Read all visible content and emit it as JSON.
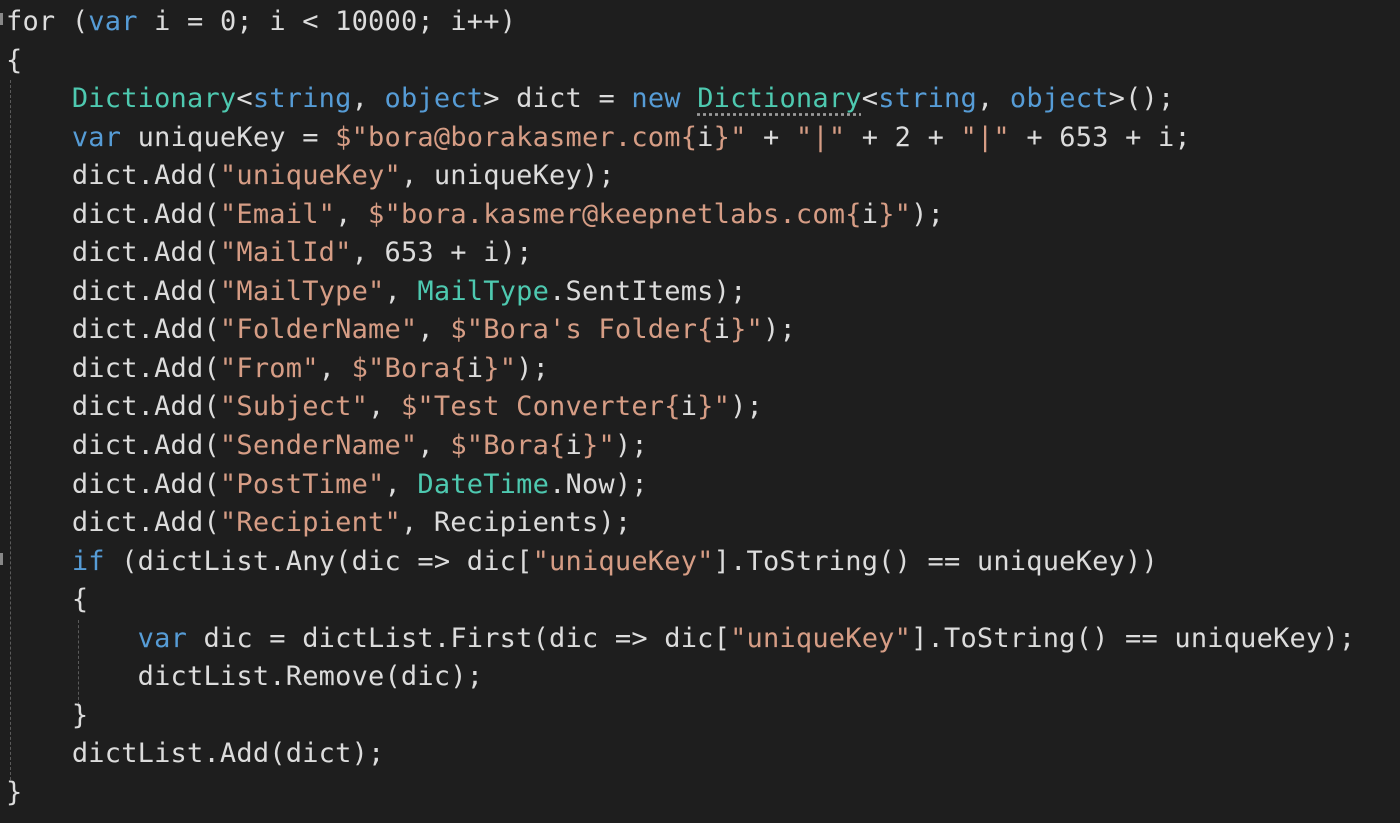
{
  "editor": {
    "theme_colors": {
      "background": "#1e1e1e",
      "keyword": "#569cd6",
      "string": "#d69d85",
      "type": "#4ec9b0",
      "plain": "#dcdcdc"
    },
    "lines": [
      [
        {
          "t": "for",
          "c": "pl"
        },
        {
          "t": " (",
          "c": "pl"
        },
        {
          "t": "var",
          "c": "kw"
        },
        {
          "t": " i = 0; i < 10000; i++)",
          "c": "pl"
        }
      ],
      [
        {
          "t": "{",
          "c": "pl"
        }
      ],
      [
        {
          "t": "    ",
          "c": "pl"
        },
        {
          "t": "Dictionary",
          "c": "ty"
        },
        {
          "t": "<",
          "c": "pl"
        },
        {
          "t": "string",
          "c": "kw"
        },
        {
          "t": ", ",
          "c": "pl"
        },
        {
          "t": "object",
          "c": "kw"
        },
        {
          "t": "> dict = ",
          "c": "pl"
        },
        {
          "t": "new",
          "c": "kw"
        },
        {
          "t": " ",
          "c": "pl"
        },
        {
          "t": "Dictionary",
          "c": "ty",
          "squiggle": true
        },
        {
          "t": "<",
          "c": "pl"
        },
        {
          "t": "string",
          "c": "kw"
        },
        {
          "t": ", ",
          "c": "pl"
        },
        {
          "t": "object",
          "c": "kw"
        },
        {
          "t": ">();",
          "c": "pl"
        }
      ],
      [
        {
          "t": "    ",
          "c": "pl"
        },
        {
          "t": "var",
          "c": "kw"
        },
        {
          "t": " uniqueKey = ",
          "c": "pl"
        },
        {
          "t": "$\"bora@borakasmer.com{",
          "c": "st"
        },
        {
          "t": "i",
          "c": "pl"
        },
        {
          "t": "}\"",
          "c": "st"
        },
        {
          "t": " + ",
          "c": "pl"
        },
        {
          "t": "\"|\"",
          "c": "st"
        },
        {
          "t": " + 2 + ",
          "c": "pl"
        },
        {
          "t": "\"|\"",
          "c": "st"
        },
        {
          "t": " + 653 + i;",
          "c": "pl"
        }
      ],
      [
        {
          "t": "    dict.Add(",
          "c": "pl"
        },
        {
          "t": "\"uniqueKey\"",
          "c": "st"
        },
        {
          "t": ", uniqueKey);",
          "c": "pl"
        }
      ],
      [
        {
          "t": "    dict.Add(",
          "c": "pl"
        },
        {
          "t": "\"Email\"",
          "c": "st"
        },
        {
          "t": ", ",
          "c": "pl"
        },
        {
          "t": "$\"bora.kasmer@keepnetlabs.com{",
          "c": "st"
        },
        {
          "t": "i",
          "c": "pl"
        },
        {
          "t": "}\"",
          "c": "st"
        },
        {
          "t": ");",
          "c": "pl"
        }
      ],
      [
        {
          "t": "    dict.Add(",
          "c": "pl"
        },
        {
          "t": "\"MailId\"",
          "c": "st"
        },
        {
          "t": ", 653 + i);",
          "c": "pl"
        }
      ],
      [
        {
          "t": "    dict.Add(",
          "c": "pl"
        },
        {
          "t": "\"MailType\"",
          "c": "st"
        },
        {
          "t": ", ",
          "c": "pl"
        },
        {
          "t": "MailType",
          "c": "ty"
        },
        {
          "t": ".SentItems);",
          "c": "pl"
        }
      ],
      [
        {
          "t": "    dict.Add(",
          "c": "pl"
        },
        {
          "t": "\"FolderName\"",
          "c": "st"
        },
        {
          "t": ", ",
          "c": "pl"
        },
        {
          "t": "$\"Bora's Folder{",
          "c": "st"
        },
        {
          "t": "i",
          "c": "pl"
        },
        {
          "t": "}\"",
          "c": "st"
        },
        {
          "t": ");",
          "c": "pl"
        }
      ],
      [
        {
          "t": "    dict.Add(",
          "c": "pl"
        },
        {
          "t": "\"From\"",
          "c": "st"
        },
        {
          "t": ", ",
          "c": "pl"
        },
        {
          "t": "$\"Bora{",
          "c": "st"
        },
        {
          "t": "i",
          "c": "pl"
        },
        {
          "t": "}\"",
          "c": "st"
        },
        {
          "t": ");",
          "c": "pl"
        }
      ],
      [
        {
          "t": "    dict.Add(",
          "c": "pl"
        },
        {
          "t": "\"Subject\"",
          "c": "st"
        },
        {
          "t": ", ",
          "c": "pl"
        },
        {
          "t": "$\"Test Converter{",
          "c": "st"
        },
        {
          "t": "i",
          "c": "pl"
        },
        {
          "t": "}\"",
          "c": "st"
        },
        {
          "t": ");",
          "c": "pl"
        }
      ],
      [
        {
          "t": "    dict.Add(",
          "c": "pl"
        },
        {
          "t": "\"SenderName\"",
          "c": "st"
        },
        {
          "t": ", ",
          "c": "pl"
        },
        {
          "t": "$\"Bora{",
          "c": "st"
        },
        {
          "t": "i",
          "c": "pl"
        },
        {
          "t": "}\"",
          "c": "st"
        },
        {
          "t": ");",
          "c": "pl"
        }
      ],
      [
        {
          "t": "    dict.Add(",
          "c": "pl"
        },
        {
          "t": "\"PostTime\"",
          "c": "st"
        },
        {
          "t": ", ",
          "c": "pl"
        },
        {
          "t": "DateTime",
          "c": "ty"
        },
        {
          "t": ".Now);",
          "c": "pl"
        }
      ],
      [
        {
          "t": "    dict.Add(",
          "c": "pl"
        },
        {
          "t": "\"Recipient\"",
          "c": "st"
        },
        {
          "t": ", Recipients);",
          "c": "pl"
        }
      ],
      [
        {
          "t": "    ",
          "c": "pl"
        },
        {
          "t": "if",
          "c": "kw"
        },
        {
          "t": " (dictList.Any(dic => dic[",
          "c": "pl"
        },
        {
          "t": "\"uniqueKey\"",
          "c": "st"
        },
        {
          "t": "].ToString() == uniqueKey))",
          "c": "pl"
        }
      ],
      [
        {
          "t": "    {",
          "c": "pl"
        }
      ],
      [
        {
          "t": "        ",
          "c": "pl"
        },
        {
          "t": "var",
          "c": "kw"
        },
        {
          "t": " dic = dictList.First(dic => dic[",
          "c": "pl"
        },
        {
          "t": "\"uniqueKey\"",
          "c": "st"
        },
        {
          "t": "].ToString() == uniqueKey);",
          "c": "pl"
        }
      ],
      [
        {
          "t": "        dictList.Remove(dic);",
          "c": "pl"
        }
      ],
      [
        {
          "t": "    }",
          "c": "pl"
        }
      ],
      [
        {
          "t": "    dictList.Add(dict);",
          "c": "pl"
        }
      ],
      [
        {
          "t": "}",
          "c": "pl"
        }
      ]
    ]
  }
}
